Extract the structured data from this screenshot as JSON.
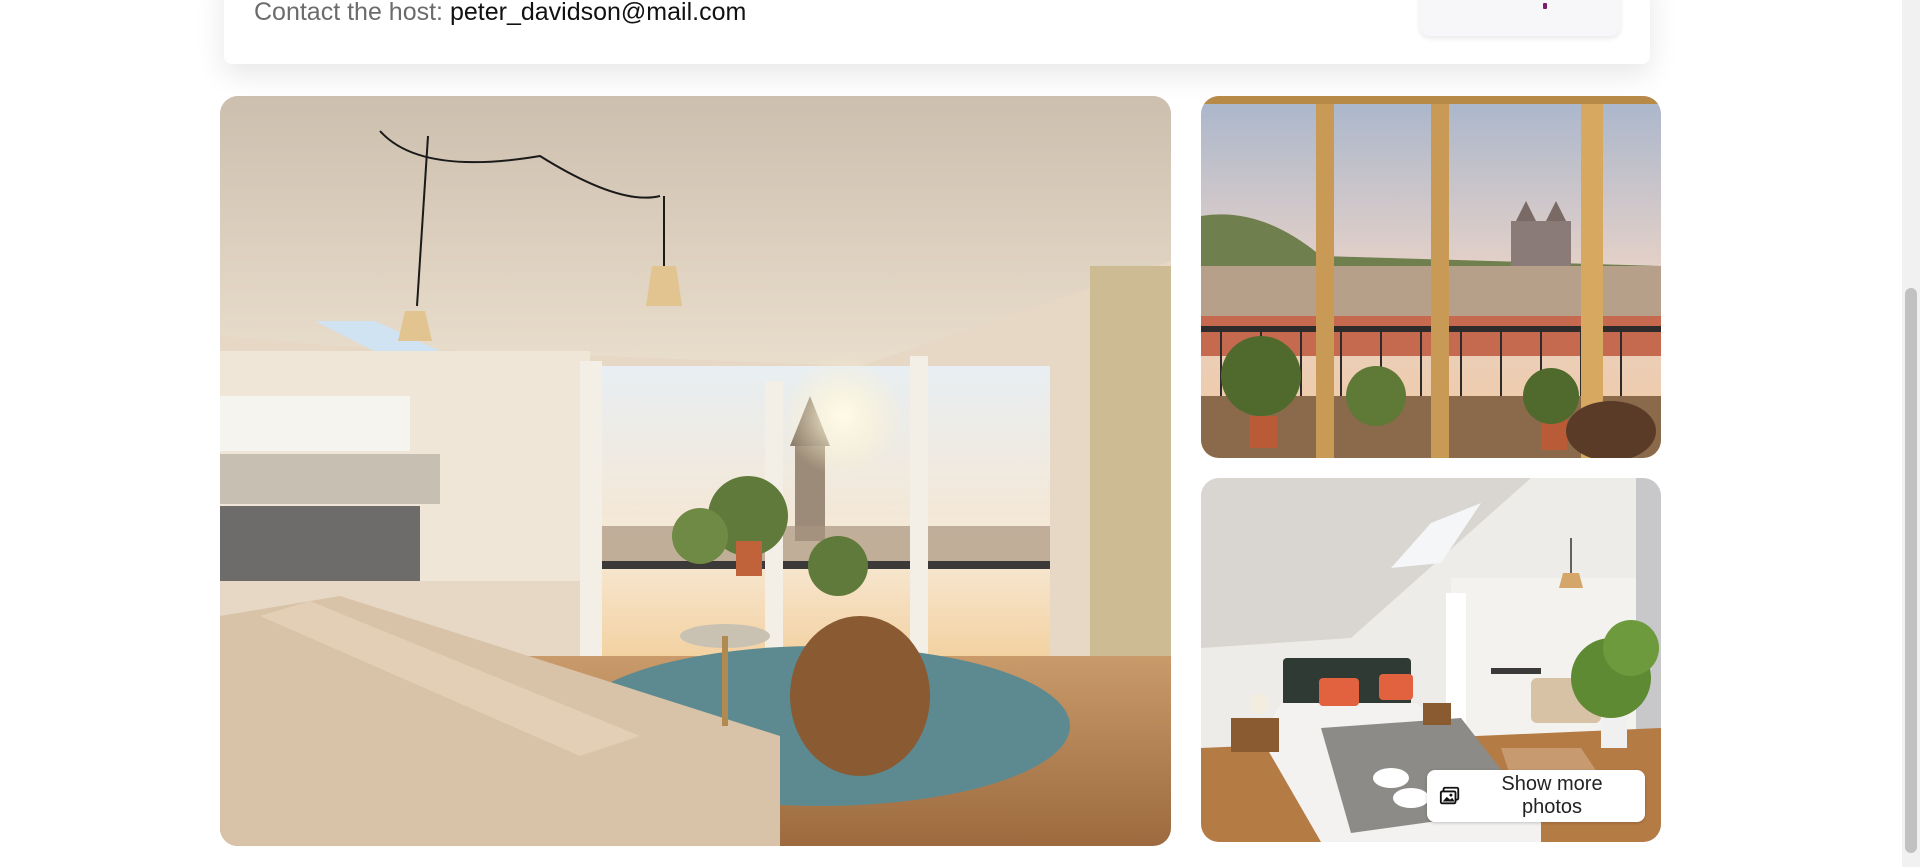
{
  "host": {
    "contact_label": "Contact the host:",
    "contact_email": "peter_davidson@mail.com"
  },
  "gallery": {
    "photos": [
      {
        "icon": "photo-living-room"
      },
      {
        "icon": "photo-balcony-view"
      },
      {
        "icon": "photo-bedroom"
      }
    ],
    "show_more_label": "Show more photos",
    "show_more_icon": "photos-icon"
  },
  "colors": {
    "accent": "#7a1d6a",
    "text": "#111111",
    "muted": "#6b6b6b"
  }
}
